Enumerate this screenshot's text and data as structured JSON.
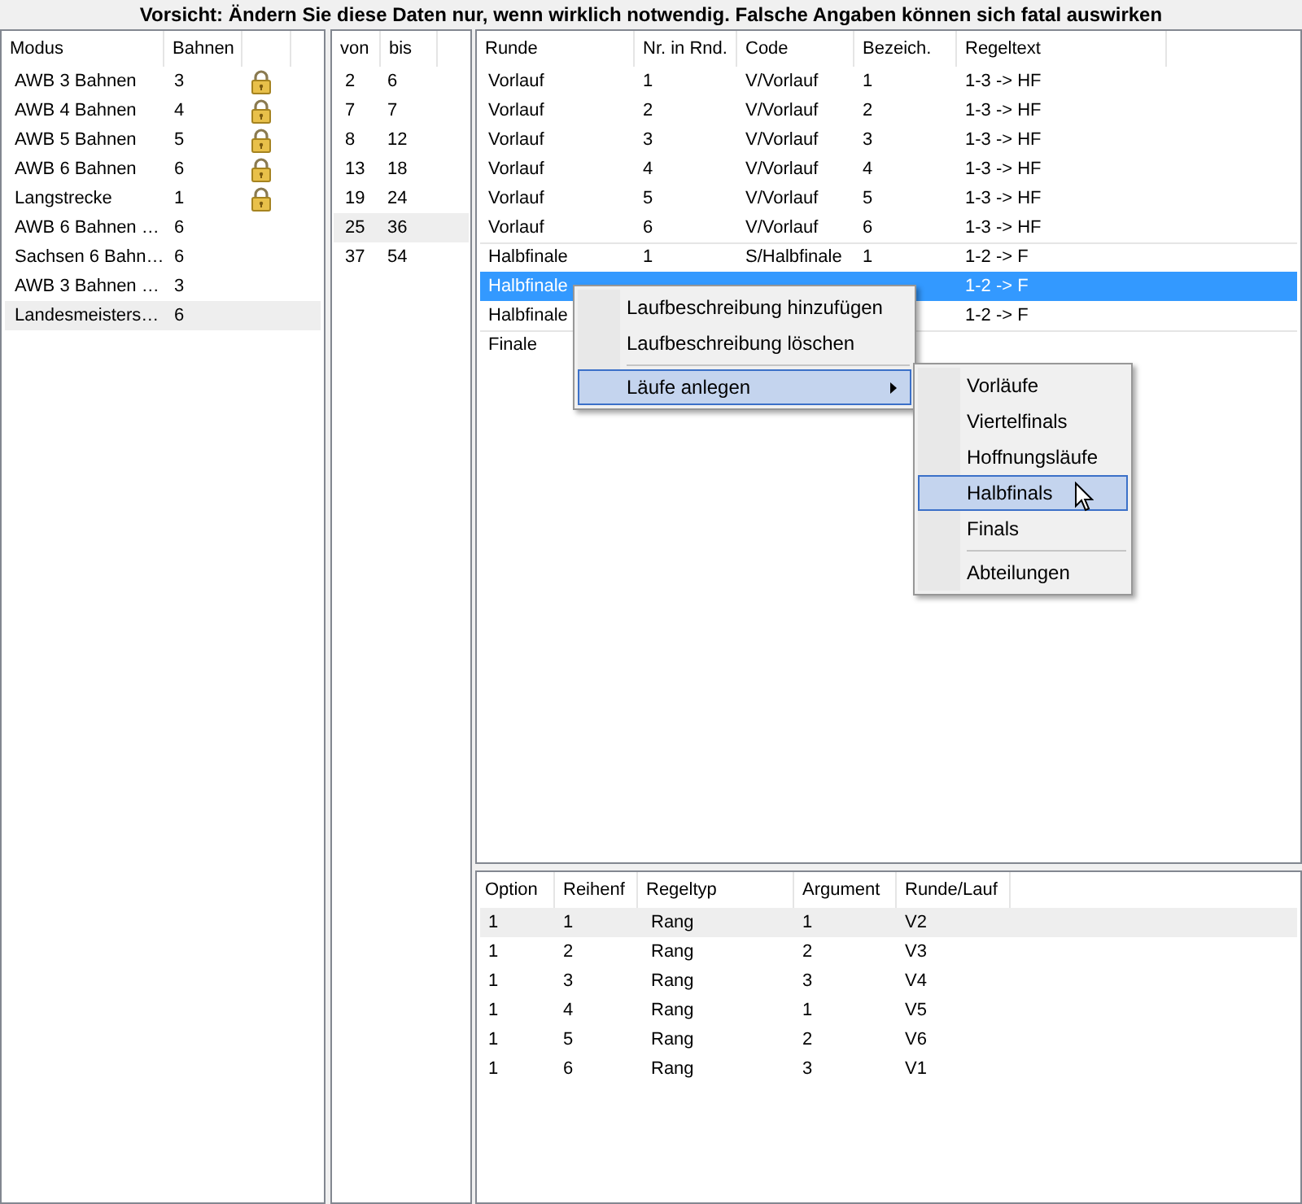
{
  "warning": "Vorsicht: Ändern Sie diese Daten nur, wenn wirklich notwendig. Falsche Angaben können sich fatal auswirken",
  "modes": {
    "columns": [
      "Modus",
      "Bahnen"
    ],
    "rows": [
      {
        "modus": "AWB 3 Bahnen",
        "bahnen": "3",
        "locked": true,
        "selected": false
      },
      {
        "modus": "AWB 4 Bahnen",
        "bahnen": "4",
        "locked": true,
        "selected": false
      },
      {
        "modus": "AWB 5 Bahnen",
        "bahnen": "5",
        "locked": true,
        "selected": false
      },
      {
        "modus": "AWB 6 Bahnen",
        "bahnen": "6",
        "locked": true,
        "selected": false
      },
      {
        "modus": "Langstrecke",
        "bahnen": "1",
        "locked": true,
        "selected": false
      },
      {
        "modus": "AWB 6 Bahnen …",
        "bahnen": "6",
        "locked": false,
        "selected": false
      },
      {
        "modus": "Sachsen 6 Bahn…",
        "bahnen": "6",
        "locked": false,
        "selected": false
      },
      {
        "modus": "AWB 3 Bahnen …",
        "bahnen": "3",
        "locked": false,
        "selected": false
      },
      {
        "modus": "Landesmeisters…",
        "bahnen": "6",
        "locked": false,
        "selected": true
      }
    ]
  },
  "ranges": {
    "columns": [
      "von",
      "bis"
    ],
    "rows": [
      {
        "von": "2",
        "bis": "6",
        "selected": false
      },
      {
        "von": "7",
        "bis": "7",
        "selected": false
      },
      {
        "von": "8",
        "bis": "12",
        "selected": false
      },
      {
        "von": "13",
        "bis": "18",
        "selected": false
      },
      {
        "von": "19",
        "bis": "24",
        "selected": false
      },
      {
        "von": "25",
        "bis": "36",
        "selected": true
      },
      {
        "von": "37",
        "bis": "54",
        "selected": false
      }
    ]
  },
  "runs": {
    "columns": [
      "Runde",
      "Nr. in Rnd.",
      "Code",
      "Bezeich.",
      "Regeltext"
    ],
    "rows": [
      {
        "cells": [
          "Vorlauf",
          "1",
          "V/Vorlauf",
          "1",
          "1-3 -> HF"
        ],
        "selected": false,
        "divider_above": false
      },
      {
        "cells": [
          "Vorlauf",
          "2",
          "V/Vorlauf",
          "2",
          "1-3 -> HF"
        ],
        "selected": false,
        "divider_above": false
      },
      {
        "cells": [
          "Vorlauf",
          "3",
          "V/Vorlauf",
          "3",
          "1-3 -> HF"
        ],
        "selected": false,
        "divider_above": false
      },
      {
        "cells": [
          "Vorlauf",
          "4",
          "V/Vorlauf",
          "4",
          "1-3 -> HF"
        ],
        "selected": false,
        "divider_above": false
      },
      {
        "cells": [
          "Vorlauf",
          "5",
          "V/Vorlauf",
          "5",
          "1-3 -> HF"
        ],
        "selected": false,
        "divider_above": false
      },
      {
        "cells": [
          "Vorlauf",
          "6",
          "V/Vorlauf",
          "6",
          "1-3 -> HF"
        ],
        "selected": false,
        "divider_above": false
      },
      {
        "cells": [
          "Halbfinale",
          "1",
          "S/Halbfinale",
          "1",
          "1-2 -> F"
        ],
        "selected": false,
        "divider_above": true
      },
      {
        "cells": [
          "Halbfinale",
          null,
          null,
          null,
          "1-2 -> F"
        ],
        "selected": true,
        "divider_above": false
      },
      {
        "cells": [
          "Halbfinale",
          null,
          null,
          null,
          "1-2 -> F"
        ],
        "selected": false,
        "divider_above": false
      },
      {
        "cells": [
          "Finale"
        ],
        "selected": false,
        "divider_above": true
      }
    ]
  },
  "context_menu": {
    "items": [
      {
        "label": "Laufbeschreibung hinzufügen",
        "selected": false,
        "submenu": false
      },
      {
        "label": "Laufbeschreibung löschen",
        "selected": false,
        "submenu": false
      },
      {
        "label": "Läufe anlegen",
        "selected": true,
        "submenu": true,
        "separator_above": true
      }
    ],
    "submenu": [
      {
        "label": "Vorläufe",
        "selected": false
      },
      {
        "label": "Viertelfinals",
        "selected": false
      },
      {
        "label": "Hoffnungsläufe",
        "selected": false
      },
      {
        "label": "Halbfinals",
        "selected": true
      },
      {
        "label": "Finals",
        "selected": false
      },
      {
        "label": "Abteilungen",
        "selected": false,
        "separator_above": true
      }
    ]
  },
  "rules": {
    "columns": [
      "Option",
      "Reihenf",
      "Regeltyp",
      "Argument",
      "Runde/Lauf"
    ],
    "rows": [
      {
        "cells": [
          "1",
          "1",
          "Rang",
          "1",
          "V2"
        ],
        "selected": true
      },
      {
        "cells": [
          "1",
          "2",
          "Rang",
          "2",
          "V3"
        ],
        "selected": false
      },
      {
        "cells": [
          "1",
          "3",
          "Rang",
          "3",
          "V4"
        ],
        "selected": false
      },
      {
        "cells": [
          "1",
          "4",
          "Rang",
          "1",
          "V5"
        ],
        "selected": false
      },
      {
        "cells": [
          "1",
          "5",
          "Rang",
          "2",
          "V6"
        ],
        "selected": false
      },
      {
        "cells": [
          "1",
          "6",
          "Rang",
          "3",
          "V1"
        ],
        "selected": false
      }
    ]
  }
}
